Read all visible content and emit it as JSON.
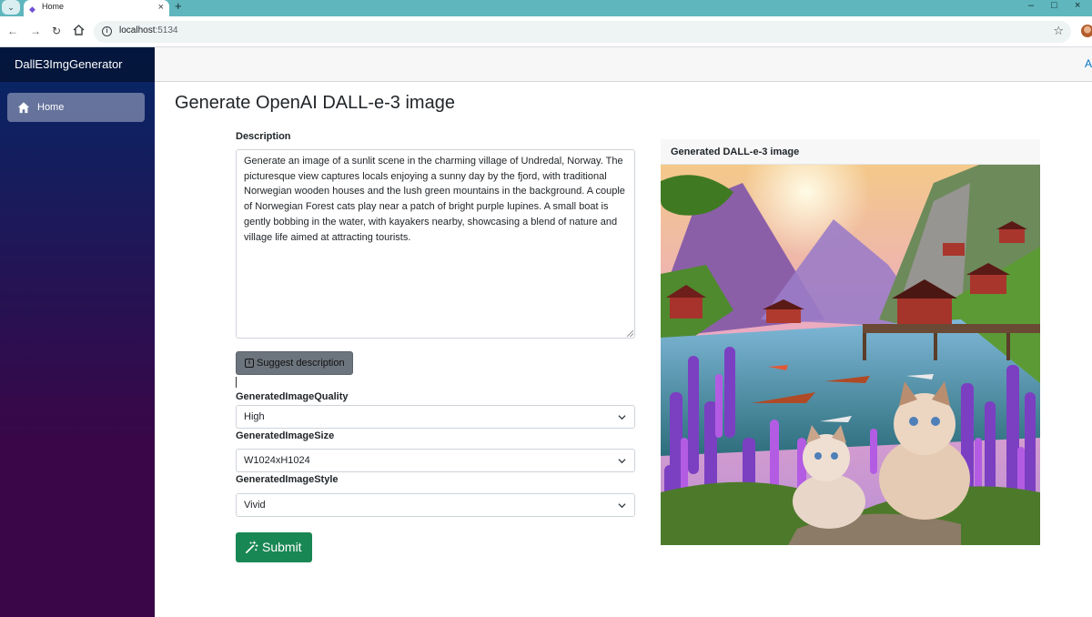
{
  "browser": {
    "tab_title": "Home",
    "url_host": "localhost",
    "url_port": ":5134",
    "colors": {
      "tabstrip": "#5fb6bd"
    }
  },
  "app": {
    "brand": "DallE3ImgGenerator",
    "nav": [
      {
        "label": "Home",
        "icon": "home-icon",
        "active": true
      }
    ],
    "topbar_link": "A",
    "colors": {
      "sidebar_top": "#052767",
      "sidebar_bottom": "#3a0647",
      "submit": "#198754",
      "suggest": "#6c757d"
    }
  },
  "form": {
    "page_title": "Generate OpenAI DALL-e-3 image",
    "description_label": "Description",
    "description_value": "Generate an image of a sunlit scene in the charming village of Undredal, Norway. The picturesque view captures locals enjoying a sunny day by the fjord, with traditional Norwegian wooden houses and the lush green mountains in the background. A couple of Norwegian Forest cats play near a patch of bright purple lupines. A small boat is gently bobbing in the water, with kayakers nearby, showcasing a blend of nature and village life aimed at attracting tourists.",
    "suggest_button": "Suggest description",
    "quality_label": "GeneratedImageQuality",
    "quality_value": "High",
    "size_label": "GeneratedImageSize",
    "size_value": "W1024xH1024",
    "style_label": "GeneratedImageStyle",
    "style_value": "Vivid",
    "submit_button": "Submit"
  },
  "result": {
    "header": "Generated DALL-e-3 image"
  }
}
